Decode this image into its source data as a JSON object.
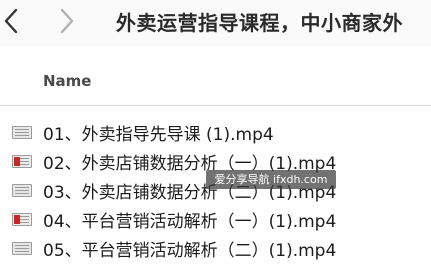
{
  "toolbar": {
    "back_icon": "chevron-left-icon",
    "forward_icon": "chevron-right-icon",
    "title": "外卖运营指导课程，中小商家外"
  },
  "list_header": {
    "name_column": "Name"
  },
  "files": [
    {
      "name": "01、外卖指导先导课 (1).mp4",
      "icon": "video-file-icon",
      "icon_style": "gray"
    },
    {
      "name": "02、外卖店铺数据分析（一）(1).mp4",
      "icon": "video-file-icon",
      "icon_style": "red"
    },
    {
      "name": "03、外卖店铺数据分析（二）(1).mp4",
      "icon": "video-file-icon",
      "icon_style": "gray"
    },
    {
      "name": "04、平台营销活动解析（一）(1).mp4",
      "icon": "video-file-icon",
      "icon_style": "red"
    },
    {
      "name": "05、平台营销活动解析（二）(1).mp4",
      "icon": "video-file-icon",
      "icon_style": "gray"
    }
  ],
  "watermark": {
    "text": "爱分享导航 ifxdh.com"
  },
  "colors": {
    "accent_red": "#c62828",
    "text": "#1d1d1f"
  }
}
